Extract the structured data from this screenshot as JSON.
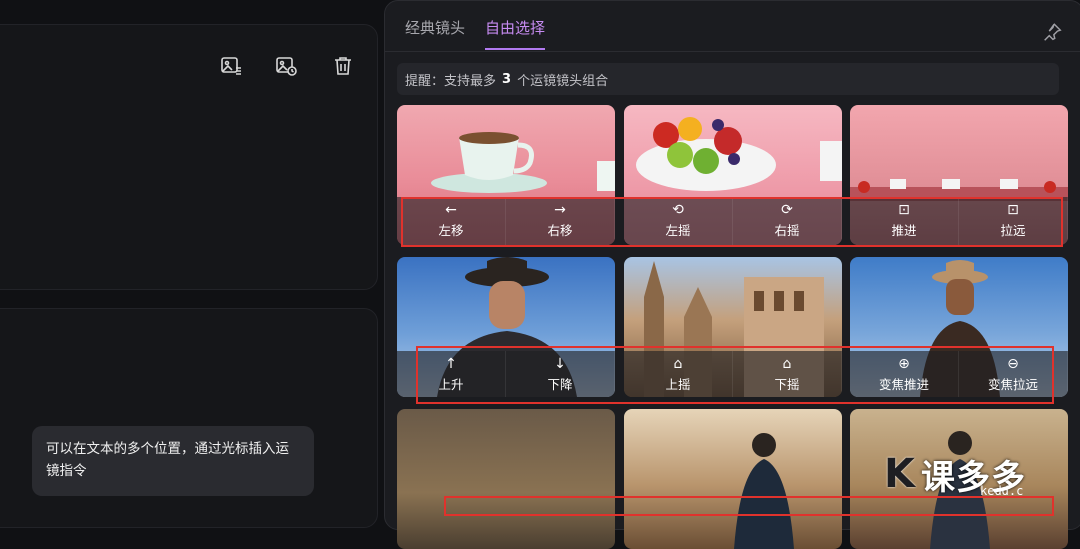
{
  "toolbar": {
    "icons": [
      "image-edit-icon",
      "image-time-icon",
      "trash-icon"
    ]
  },
  "tooltip": {
    "text": "可以在文本的多个位置，通过光标插入运镜指令"
  },
  "panel": {
    "tabs": [
      {
        "label": "经典镜头",
        "active": false
      },
      {
        "label": "自由选择",
        "active": true
      }
    ],
    "tip_prefix": "提醒：支持最多",
    "tip_count": "3",
    "tip_suffix": "个运镜镜头组合"
  },
  "cards": [
    {
      "scene": "teacup",
      "buttons": [
        {
          "label": "左移",
          "icon": "←"
        },
        {
          "label": "右移",
          "icon": "→"
        }
      ]
    },
    {
      "scene": "fruit",
      "buttons": [
        {
          "label": "左摇",
          "icon": "⟲"
        },
        {
          "label": "右摇",
          "icon": "⟳"
        }
      ]
    },
    {
      "scene": "table",
      "buttons": [
        {
          "label": "推进",
          "icon": "⊡"
        },
        {
          "label": "拉远",
          "icon": "⊡"
        }
      ]
    },
    {
      "scene": "cowboy",
      "buttons": [
        {
          "label": "上升",
          "icon": "↑"
        },
        {
          "label": "下降",
          "icon": "↓"
        }
      ]
    },
    {
      "scene": "cathedral",
      "buttons": [
        {
          "label": "上摇",
          "icon": "⌂"
        },
        {
          "label": "下摇",
          "icon": "⌂"
        }
      ]
    },
    {
      "scene": "cowboy2",
      "buttons": [
        {
          "label": "变焦推进",
          "icon": "⊕"
        },
        {
          "label": "变焦拉远",
          "icon": "⊖"
        }
      ]
    },
    {
      "scene": "ruins",
      "buttons": []
    },
    {
      "scene": "street",
      "buttons": []
    },
    {
      "scene": "street2",
      "buttons": []
    }
  ],
  "watermark": {
    "text": "课多多",
    "sub": "kedd.c"
  }
}
